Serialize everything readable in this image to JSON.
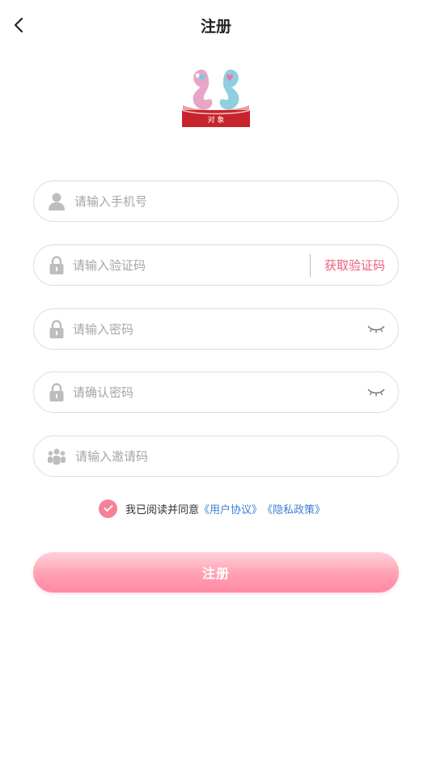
{
  "header": {
    "title": "注册"
  },
  "logo": {
    "brand_text": "对 象"
  },
  "form": {
    "phone_placeholder": "请输入手机号",
    "code_placeholder": "请输入验证码",
    "get_code_label": "获取验证码",
    "password_placeholder": "请输入密码",
    "confirm_password_placeholder": "请确认密码",
    "invite_placeholder": "请输入邀请码"
  },
  "agreement": {
    "checked": true,
    "prefix": "我已阅读并同意",
    "user_agreement": "《用户协议》",
    "privacy_policy": "《隐私政策》"
  },
  "submit_label": "注册",
  "colors": {
    "accent": "#f58199",
    "link": "#3a7fd6",
    "get_code": "#ec5f7a",
    "placeholder": "#a6a6a6"
  },
  "icons": [
    "back-arrow-icon",
    "user-icon",
    "lock-icon",
    "eye-closed-icon",
    "group-icon",
    "check-icon"
  ]
}
